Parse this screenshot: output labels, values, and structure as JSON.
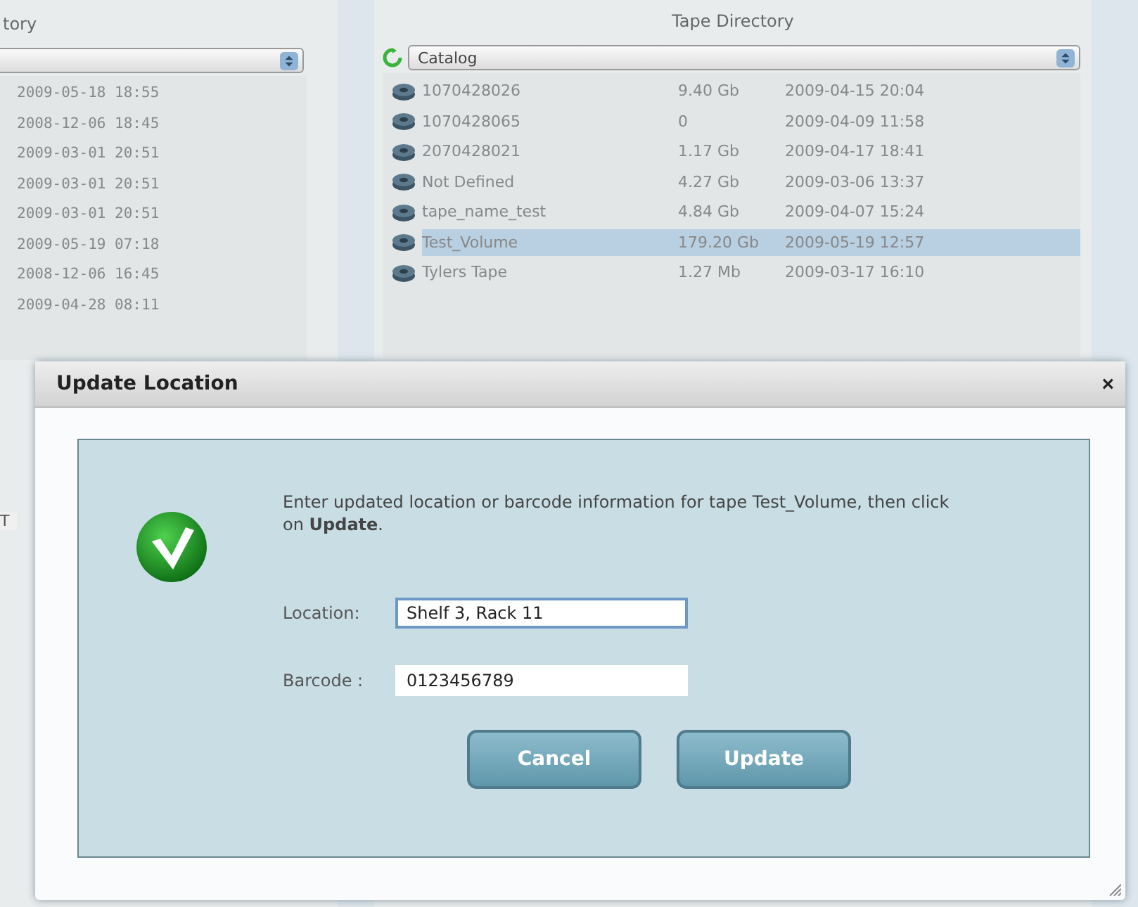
{
  "left_panel": {
    "title": "tory",
    "dates": [
      "2009-05-18 18:55",
      "2008-12-06 18:45",
      "2009-03-01 20:51",
      "2009-03-01 20:51",
      "2009-03-01 20:51",
      "2009-05-19 07:18",
      "2008-12-06 16:45",
      "2009-04-28 08:11"
    ],
    "column_fragment": "T"
  },
  "tape_directory": {
    "title": "Tape Directory",
    "select": {
      "value": "Catalog"
    },
    "rows": [
      {
        "name": "1070428026",
        "size": "9.40 Gb",
        "date": "2009-04-15 20:04",
        "selected": false
      },
      {
        "name": "1070428065",
        "size": "0",
        "date": "2009-04-09 11:58",
        "selected": false
      },
      {
        "name": "2070428021",
        "size": "1.17 Gb",
        "date": "2009-04-17 18:41",
        "selected": false
      },
      {
        "name": "Not Defined",
        "size": "4.27 Gb",
        "date": "2009-03-06 13:37",
        "selected": false
      },
      {
        "name": "tape_name_test",
        "size": "4.84 Gb",
        "date": "2009-04-07 15:24",
        "selected": false
      },
      {
        "name": "Test_Volume",
        "size": "179.20 Gb",
        "date": "2009-05-19 12:57",
        "selected": true
      },
      {
        "name": "Tylers Tape",
        "size": "1.27 Mb",
        "date": "2009-03-17 16:10",
        "selected": false
      }
    ]
  },
  "dialog": {
    "title": "Update Location",
    "close": "×",
    "message": "Enter updated location or barcode information for tape Test_Volume, then click on **Update**.",
    "fields": [
      {
        "label": "Location:",
        "value": "Shelf 3, Rack 11",
        "focused": true
      },
      {
        "label": "Barcode :",
        "value": "0123456789",
        "focused": false
      }
    ],
    "buttons": [
      "Cancel",
      "Update"
    ]
  }
}
